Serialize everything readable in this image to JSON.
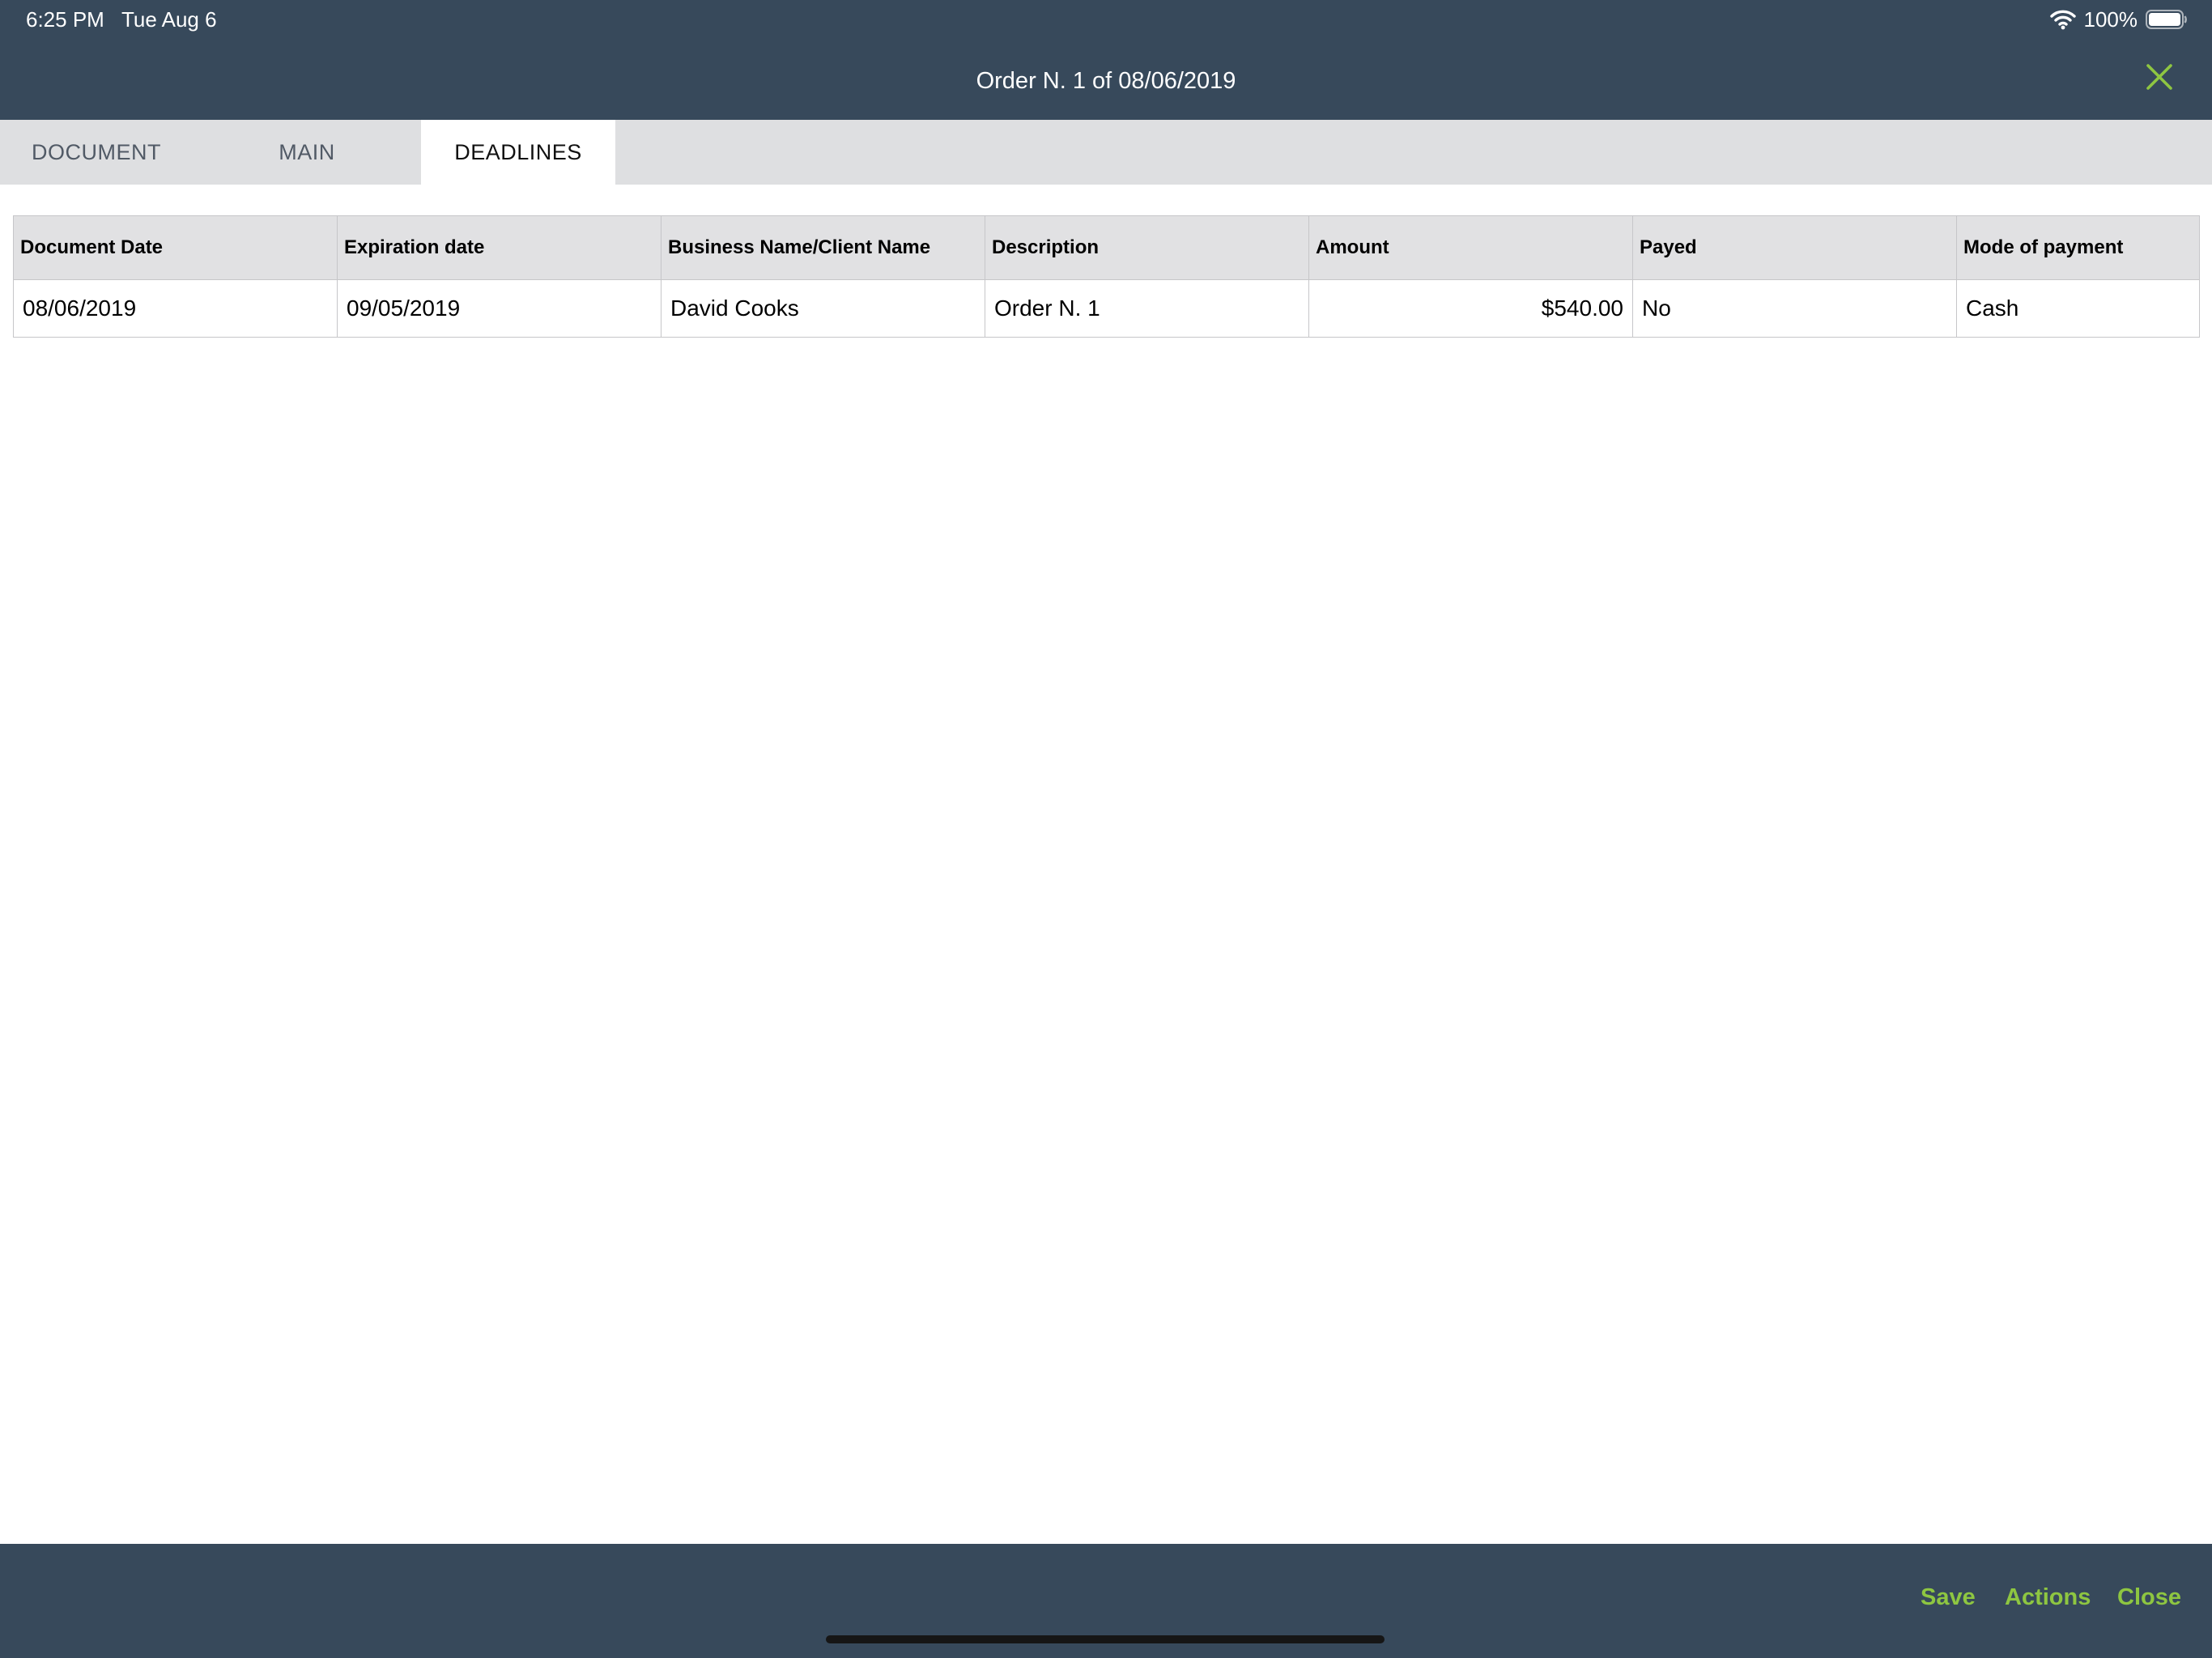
{
  "status_bar": {
    "time": "6:25 PM",
    "date": "Tue Aug 6",
    "battery_percent": "100%",
    "battery_level": 1.0
  },
  "header": {
    "title": "Order N. 1 of 08/06/2019",
    "close_icon": "close-x-icon",
    "accent_color": "#8ec641",
    "bar_color": "#37495b"
  },
  "tabs": [
    {
      "label": "DOCUMENT",
      "active": false
    },
    {
      "label": "MAIN",
      "active": false
    },
    {
      "label": "DEADLINES",
      "active": true
    }
  ],
  "deadlines_table": {
    "columns": [
      "Document Date",
      "Expiration date",
      "Business Name/Client Name",
      "Description",
      "Amount",
      "Payed",
      "Mode of payment"
    ],
    "rows": [
      [
        "08/06/2019",
        "09/05/2019",
        "David Cooks",
        "Order N. 1",
        "$540.00",
        "No",
        "Cash"
      ]
    ]
  },
  "footer": {
    "save_label": "Save",
    "actions_label": "Actions",
    "close_label": "Close"
  }
}
